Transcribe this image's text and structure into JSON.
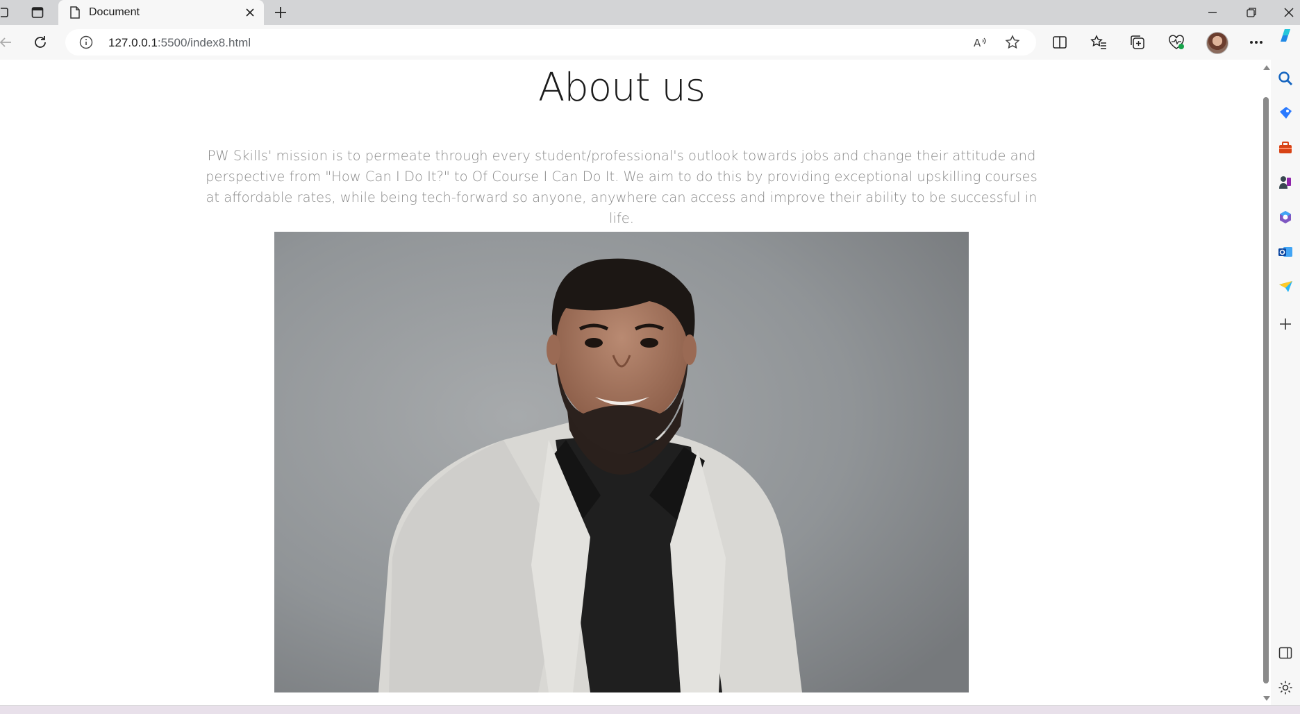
{
  "tab": {
    "title": "Document"
  },
  "address_bar": {
    "host": "127.0.0.1",
    "path": ":5500/index8.html"
  },
  "page": {
    "heading": "About us",
    "mission": "PW Skills' mission is to permeate through every student/professional's outlook towards jobs and change their attitude and perspective from \"How Can I Do It?\" to Of Course I Can Do It. We aim to do this by providing exceptional upskilling courses at affordable rates, while being tech-forward so anyone, anywhere can access and improve their ability to be successful in life."
  },
  "icons": {
    "toolbar": [
      "back-icon",
      "refresh-icon",
      "info-icon",
      "read-aloud-icon",
      "favorite-star-icon",
      "split-screen-icon",
      "favorites-icon",
      "collections-icon",
      "browser-essentials-icon",
      "more-icon"
    ],
    "sidebar": [
      "search-icon",
      "shopping-icon",
      "tools-icon",
      "games-icon",
      "microsoft365-icon",
      "outlook-icon",
      "drop-icon",
      "add-icon",
      "sidebar-toggle-icon",
      "settings-icon"
    ]
  },
  "colors": {
    "page_bg": "#ffffff",
    "heading": "#1b1b1b",
    "body_text": "#8a8a8a",
    "chrome_bg": "#f7f7f7",
    "tabstrip_bg": "#d3d4d6"
  }
}
